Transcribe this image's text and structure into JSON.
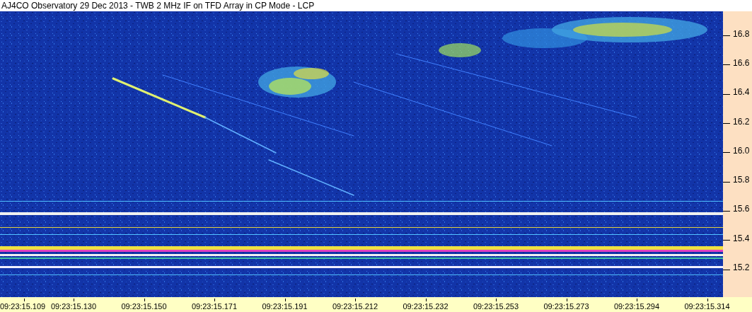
{
  "window": {
    "title": "AJ4CO Observatory 29 Dec 2013 - TWB 2 MHz IF on TFD Array in CP Mode - LCP"
  },
  "frequency_axis": {
    "labels": [
      "16.8",
      "16.6",
      "16.4",
      "16.2",
      "16.0",
      "15.8",
      "15.6",
      "15.4",
      "15.2"
    ]
  },
  "time_axis": {
    "labels": [
      "09:23:15.109",
      "09:23:15.130",
      "09:23:15.150",
      "09:23:15.171",
      "09:23:15.191",
      "09:23:15.212",
      "09:23:15.232",
      "09:23:15.253",
      "09:23:15.273",
      "09:23:15.294",
      "09:23:15.314"
    ]
  }
}
